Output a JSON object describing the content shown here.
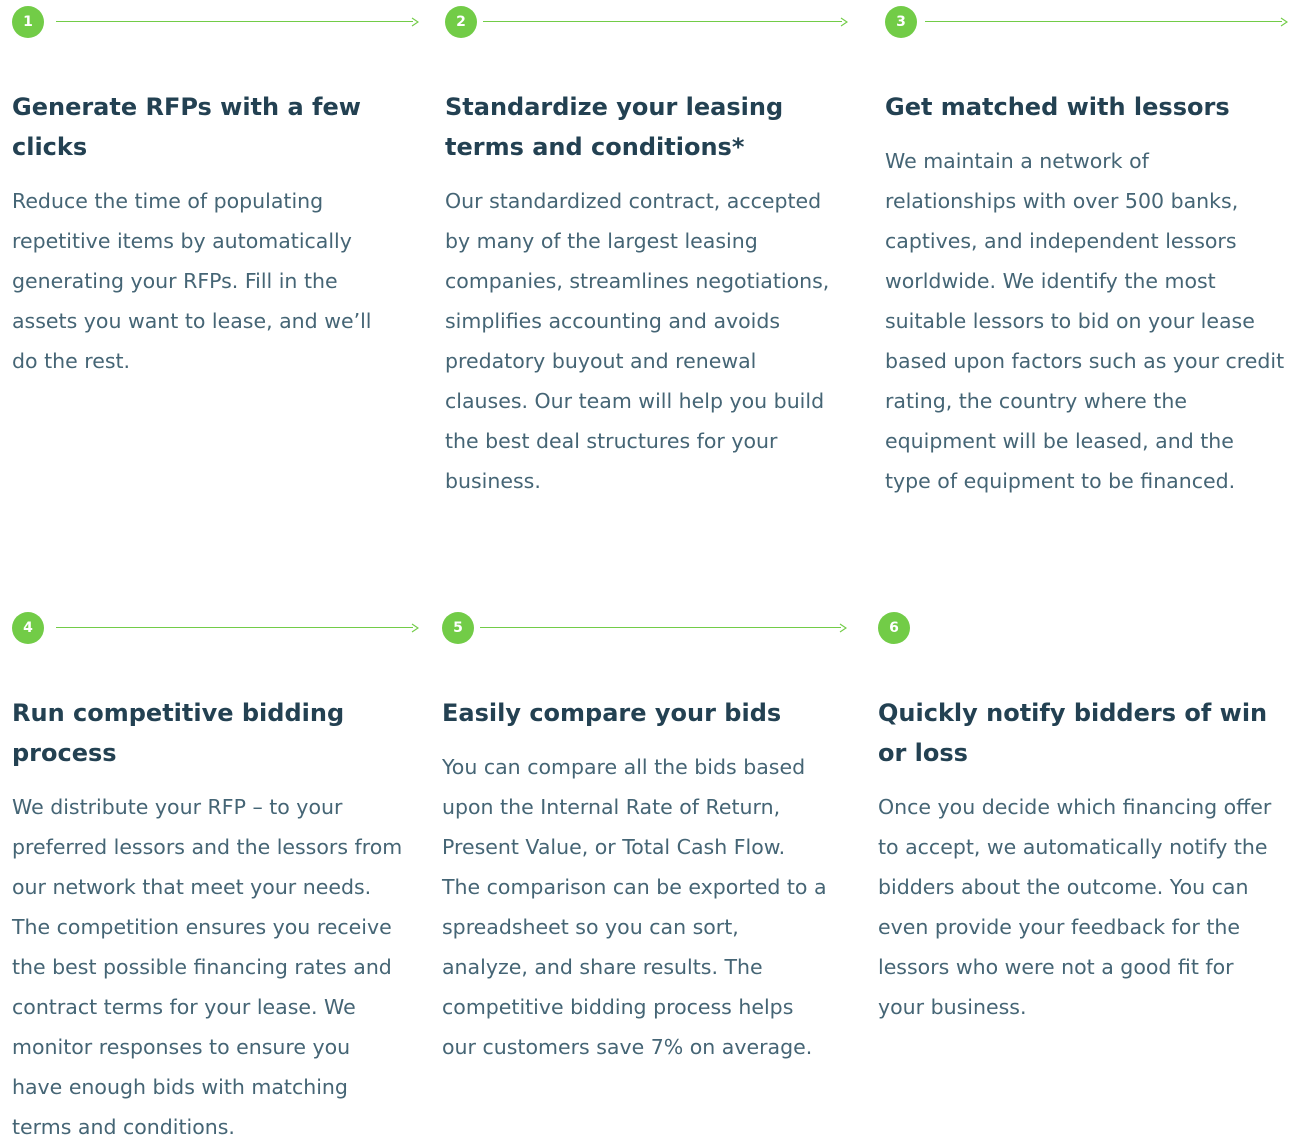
{
  "accent_color": "#72cc47",
  "title_color": "#234152",
  "text_color": "#456575",
  "connector_icon": "arrow-right-icon",
  "steps": [
    {
      "number": "1",
      "title": "Generate RFPs with a few clicks",
      "description": "Reduce the time of populating repetitive items by automatically generating your RFPs. Fill in the assets you want to lease, and we’ll do the rest."
    },
    {
      "number": "2",
      "title": "Standardize your leasing terms and conditions*",
      "description": "Our standardized contract, accepted by many of the largest leasing companies, streamlines negotiations, simplifies accounting and avoids predatory buyout and renewal clauses. Our team will help you build the best deal structures for your business."
    },
    {
      "number": "3",
      "title": "Get matched with lessors",
      "description": "We maintain a network of relationships with over 500 banks, captives, and independent lessors worldwide. We identify the most suitable lessors to bid on your lease based upon factors such as your credit rating, the country where the equipment will be leased, and the type of equipment to be financed."
    },
    {
      "number": "4",
      "title": "Run competitive bidding process",
      "description": "We distribute your RFP – to your preferred lessors and the lessors from our network that meet your needs. The competition ensures you receive the best possible financing rates and contract terms for your lease. We monitor responses to ensure you have enough bids with matching terms and conditions."
    },
    {
      "number": "5",
      "title": "Easily compare your bids",
      "description": "You can compare all the bids based upon the Internal Rate of Return, Present Value, or Total Cash Flow. The comparison can be exported to a spreadsheet so you can sort, analyze, and share results. The competitive bidding process helps our customers save 7% on average."
    },
    {
      "number": "6",
      "title": "Quickly notify bidders of win or loss",
      "description": "Once you decide which financing offer to accept, we automatically notify the bidders about the outcome. You can even provide your feedback for the lessors who were not a good fit for your business."
    }
  ]
}
